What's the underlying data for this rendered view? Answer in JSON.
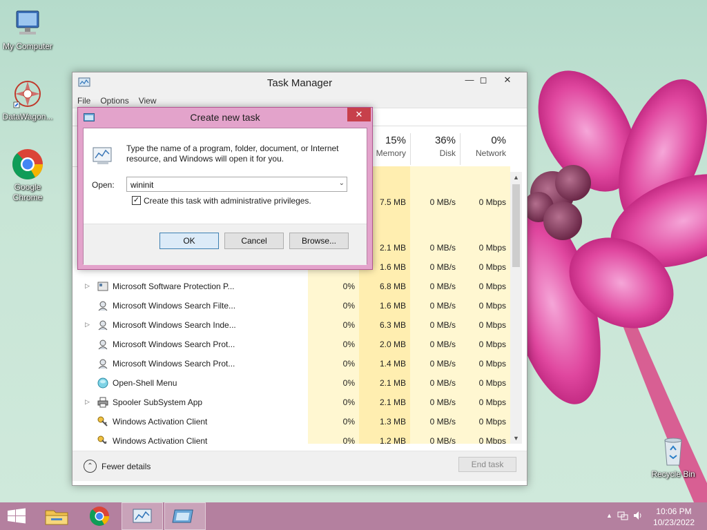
{
  "desktop": {
    "icons": [
      {
        "label": "My Computer",
        "icon": "computer-icon"
      },
      {
        "label": "DataWagon...",
        "icon": "datawagon-icon"
      },
      {
        "label": "Google Chrome",
        "icon": "chrome-icon"
      },
      {
        "label": "Recycle Bin",
        "icon": "recycle-bin-icon"
      }
    ]
  },
  "task_manager": {
    "title": "Task Manager",
    "menu": [
      "File",
      "Options",
      "View"
    ],
    "columns": [
      {
        "pct": "15%",
        "name": "Memory"
      },
      {
        "pct": "36%",
        "name": "Disk"
      },
      {
        "pct": "0%",
        "name": "Network"
      }
    ],
    "partial_rows": [
      {
        "mem": "7.5 MB",
        "disk": "0 MB/s",
        "net": "0 Mbps"
      },
      {
        "mem": "2.1 MB",
        "disk": "0 MB/s",
        "net": "0 Mbps"
      },
      {
        "mem": "1.6 MB",
        "disk": "0 MB/s",
        "net": "0 Mbps"
      }
    ],
    "rows": [
      {
        "name": "Microsoft Software Protection P...",
        "expand": true,
        "icon": "service-icon",
        "cpu": "0%",
        "mem": "6.8 MB",
        "disk": "0 MB/s",
        "net": "0 Mbps"
      },
      {
        "name": "Microsoft Windows Search Filte...",
        "expand": false,
        "icon": "search-process-icon",
        "cpu": "0%",
        "mem": "1.6 MB",
        "disk": "0 MB/s",
        "net": "0 Mbps"
      },
      {
        "name": "Microsoft Windows Search Inde...",
        "expand": true,
        "icon": "search-process-icon",
        "cpu": "0%",
        "mem": "6.3 MB",
        "disk": "0 MB/s",
        "net": "0 Mbps"
      },
      {
        "name": "Microsoft Windows Search Prot...",
        "expand": false,
        "icon": "search-process-icon",
        "cpu": "0%",
        "mem": "2.0 MB",
        "disk": "0 MB/s",
        "net": "0 Mbps"
      },
      {
        "name": "Microsoft Windows Search Prot...",
        "expand": false,
        "icon": "search-process-icon",
        "cpu": "0%",
        "mem": "1.4 MB",
        "disk": "0 MB/s",
        "net": "0 Mbps"
      },
      {
        "name": "Open-Shell Menu",
        "expand": false,
        "icon": "open-shell-icon",
        "cpu": "0%",
        "mem": "2.1 MB",
        "disk": "0 MB/s",
        "net": "0 Mbps"
      },
      {
        "name": "Spooler SubSystem App",
        "expand": true,
        "icon": "printer-icon",
        "cpu": "0%",
        "mem": "2.1 MB",
        "disk": "0 MB/s",
        "net": "0 Mbps"
      },
      {
        "name": "Windows Activation Client",
        "expand": false,
        "icon": "activation-icon",
        "cpu": "0%",
        "mem": "1.3 MB",
        "disk": "0 MB/s",
        "net": "0 Mbps"
      },
      {
        "name": "Windows Activation Client",
        "expand": false,
        "icon": "activation-icon",
        "cpu": "0%",
        "mem": "1.2 MB",
        "disk": "0 MB/s",
        "net": "0 Mbps"
      }
    ],
    "fewer_details": "Fewer details",
    "end_task": "End task"
  },
  "dialog": {
    "title": "Create new task",
    "description": "Type the name of a program, folder, document, or Internet resource, and Windows will open it for you.",
    "open_label": "Open:",
    "open_value": "wininit",
    "checkbox_label": "Create this task with administrative privileges.",
    "checkbox_checked": true,
    "ok": "OK",
    "cancel": "Cancel",
    "browse": "Browse..."
  },
  "taskbar": {
    "time": "10:06 PM",
    "date": "10/23/2022"
  },
  "colors": {
    "accent_pink": "#e3a3cb",
    "taskbar": "#b4809f",
    "close_red": "#c7404b",
    "column_highlight": "#fff4c4"
  }
}
